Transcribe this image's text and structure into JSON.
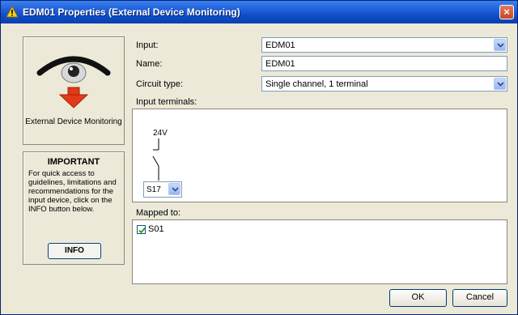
{
  "window": {
    "title": "EDM01 Properties (External Device Monitoring)",
    "close_label": "×"
  },
  "icons": {
    "title": "warning-triangle-icon",
    "device": "eye-monitor-icon",
    "arrow": "red-down-arrow-icon"
  },
  "device_panel": {
    "label": "External Device Monitoring"
  },
  "important": {
    "title": "IMPORTANT",
    "text": "For quick access to guidelines, limitations and recommendations for the input device, click on the INFO button below.",
    "info_button": "INFO"
  },
  "form": {
    "input_label": "Input:",
    "input_value": "EDM01",
    "name_label": "Name:",
    "name_value": "EDM01",
    "circuit_label": "Circuit type:",
    "circuit_value": "Single channel, 1 terminal",
    "terminals_label": "Input terminals:",
    "voltage": "24V",
    "terminal_value": "S17",
    "mapped_label": "Mapped to:",
    "mapped_items": [
      {
        "label": "S01",
        "checked": true
      }
    ]
  },
  "buttons": {
    "ok": "OK",
    "cancel": "Cancel"
  },
  "colors": {
    "titlebar": "#0d4bc6",
    "dialog_bg": "#ece9d8",
    "arrow_red": "#e03a1a"
  }
}
